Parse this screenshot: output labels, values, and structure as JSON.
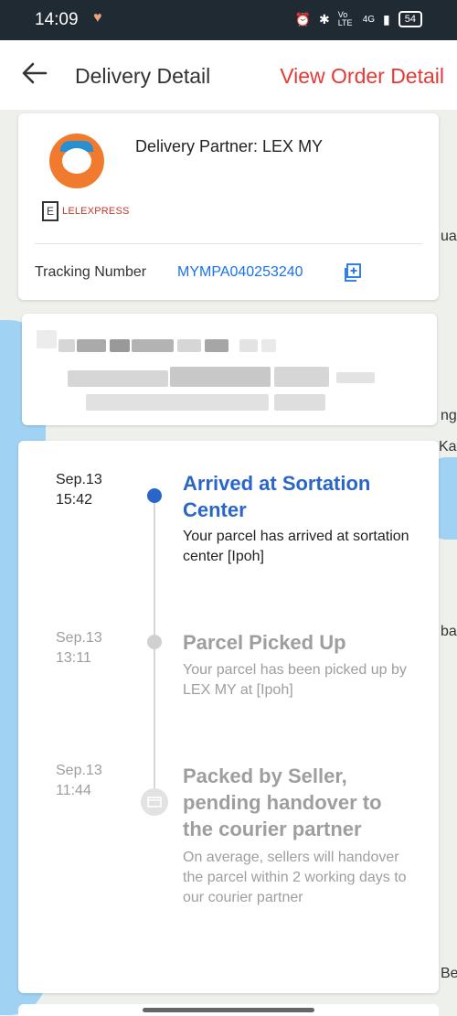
{
  "status_bar": {
    "time": "14:09",
    "signal_text": "4G",
    "volte_text": "Vo LTE",
    "battery": "54"
  },
  "header": {
    "title": "Delivery Detail",
    "view_order_label": "View Order Detail"
  },
  "partner": {
    "name": "Delivery Partner: LEX MY",
    "brand_text": "LELEXPRESS",
    "brand_box": "E",
    "tracking_label": "Tracking Number",
    "tracking_number": "MYMPA040253240"
  },
  "map_labels": {
    "l1": "uala",
    "l2": "ng",
    "l3": "Ka",
    "l4": "ba",
    "l5": "Be"
  },
  "timeline": [
    {
      "date": "Sep.13",
      "time": "15:42",
      "title": "Arrived at Sortation Center",
      "desc_lead": "Your parcel has arrived at sortation center ",
      "desc_loc": "[Ipoh]",
      "active": true
    },
    {
      "date": "Sep.13",
      "time": "13:11",
      "title": "Parcel Picked Up",
      "desc_lead": "Your parcel has been picked up by LEX MY at ",
      "desc_loc": "[Ipoh]",
      "active": false
    },
    {
      "date": "Sep.13",
      "time": "11:44",
      "title": "Packed by Seller, pending handover to the courier partner",
      "desc_lead": "On average, sellers will handover the parcel within 2 working days to our courier partner",
      "desc_loc": "",
      "active": false
    }
  ],
  "colors": {
    "accent_red": "#e53935",
    "link_blue": "#1a73e8",
    "active_title": "#2a66c9",
    "inactive": "#9e9e9e"
  }
}
